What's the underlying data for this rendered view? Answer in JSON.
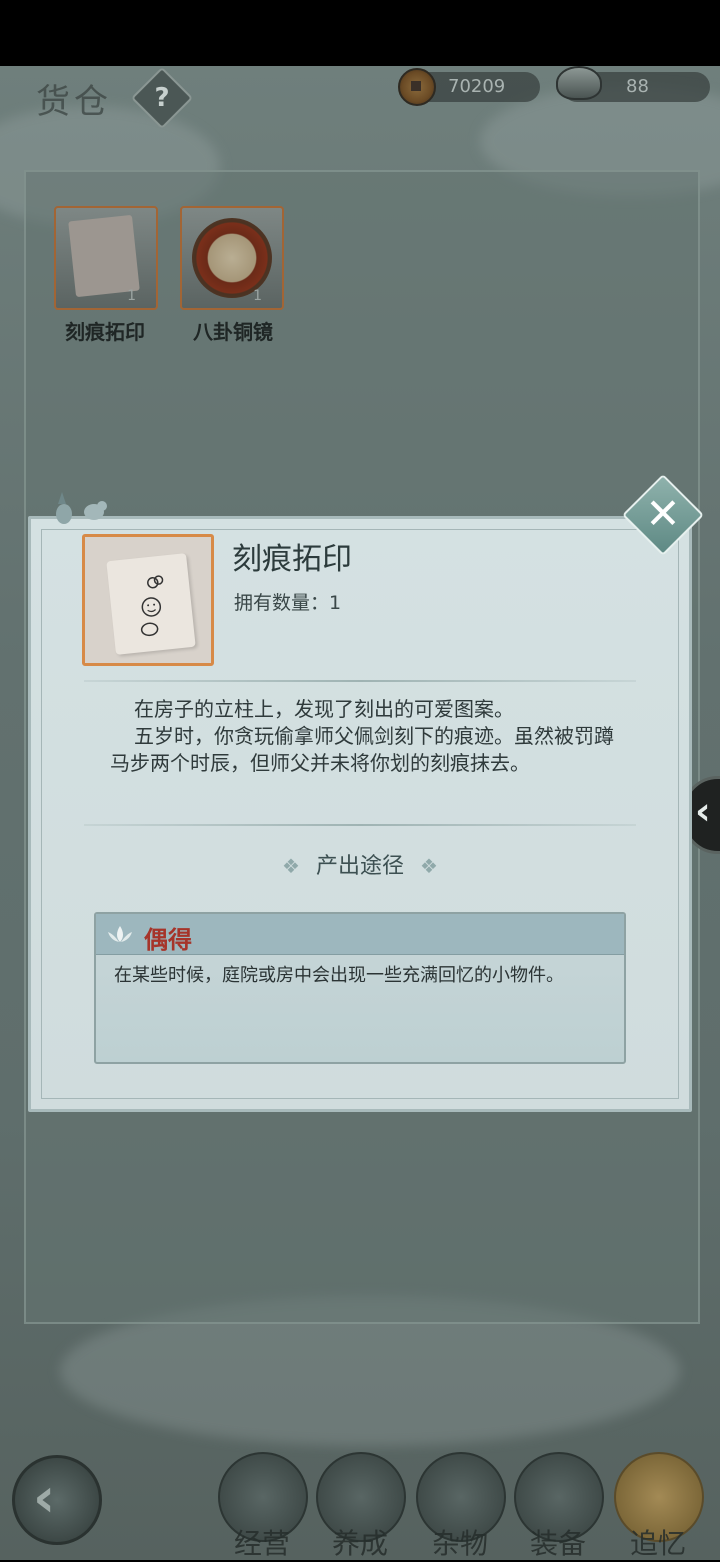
{
  "header": {
    "title": "货仓",
    "help_glyph": "?",
    "currencies": [
      {
        "icon": "copper-coin-icon",
        "value": "70209"
      },
      {
        "icon": "silver-ingot-icon",
        "value": "88"
      }
    ]
  },
  "inventory": {
    "items": [
      {
        "name": "刻痕拓印",
        "count": "1",
        "icon": "paper-rubbing-icon"
      },
      {
        "name": "八卦铜镜",
        "count": "1",
        "icon": "bagua-mirror-icon"
      }
    ]
  },
  "detail": {
    "title": "刻痕拓印",
    "count_text": "拥有数量：1",
    "description": [
      "在房子的立柱上，发现了刻出的可爱图案。",
      "五岁时，你贪玩偷拿师父佩剑刻下的痕迹。虽然被罚蹲马步两个时辰，但师父并未将你划的刻痕抹去。"
    ],
    "source_heading": "产出途径",
    "source": {
      "title": "偶得",
      "text": "在某些时候，庭院或房中会出现一些充满回忆的小物件。"
    },
    "close_glyph": "✕"
  },
  "side": {
    "collapse_glyph": "‹"
  },
  "nav": {
    "back_glyph": "‹",
    "tabs": [
      {
        "label": "经营",
        "icon": "bowl-icon"
      },
      {
        "label": "养成",
        "icon": "orb-icon"
      },
      {
        "label": "杂物",
        "icon": "bundle-icon"
      },
      {
        "label": "装备",
        "icon": "robe-icon"
      },
      {
        "label": "追忆",
        "icon": "envelope-icon"
      }
    ]
  }
}
